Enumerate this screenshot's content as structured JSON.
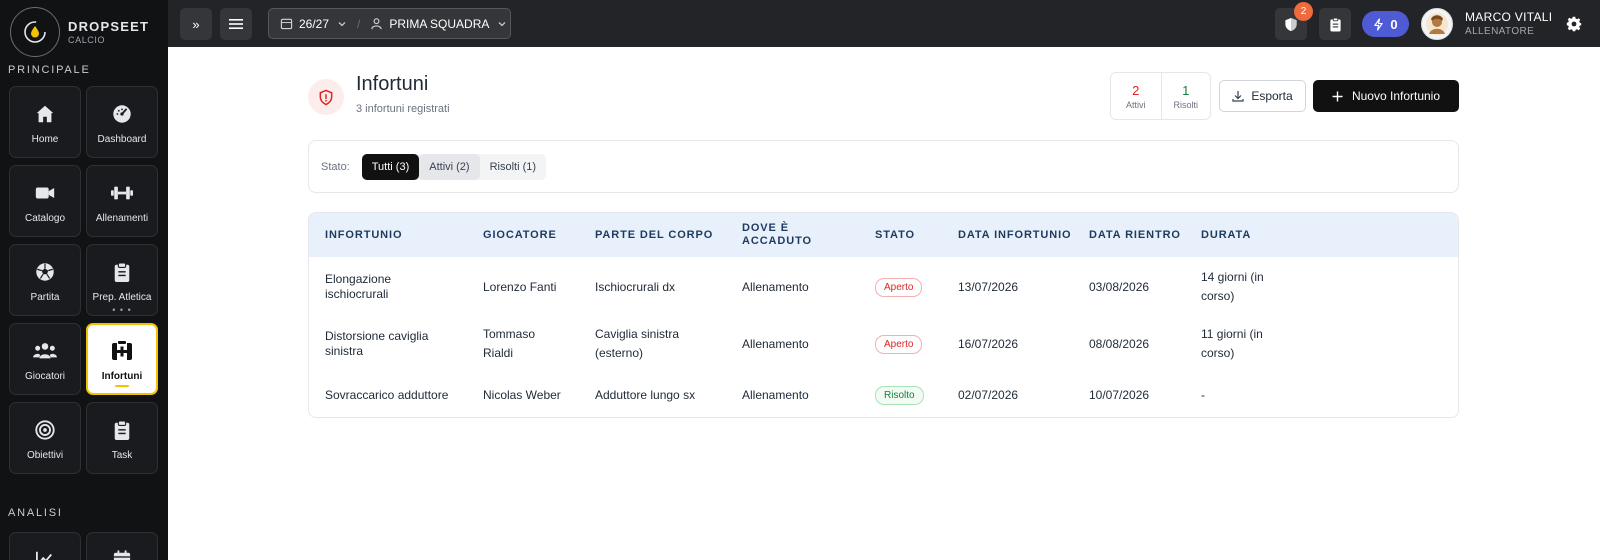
{
  "brand": {
    "name": "DROPSEET",
    "sub": "CALCIO"
  },
  "sidebar": {
    "section_main": "PRINCIPALE",
    "section_analysis": "ANALISI",
    "items": [
      {
        "label": "Home",
        "icon": "home-icon"
      },
      {
        "label": "Dashboard",
        "icon": "dashboard-icon"
      },
      {
        "label": "Catalogo",
        "icon": "video-icon"
      },
      {
        "label": "Allenamenti",
        "icon": "dumbbell-icon"
      },
      {
        "label": "Partita",
        "icon": "ball-icon"
      },
      {
        "label": "Prep. Atletica",
        "icon": "clipboard-icon"
      },
      {
        "label": "Giocatori",
        "icon": "users-icon"
      },
      {
        "label": "Infortuni",
        "icon": "medical-icon"
      },
      {
        "label": "Obiettivi",
        "icon": "target-icon"
      },
      {
        "label": "Task",
        "icon": "task-icon"
      }
    ],
    "more_dots": "• • •"
  },
  "topbar": {
    "expand_glyph": "»",
    "season": "26/27",
    "separator": "/",
    "team": "PRIMA SQUADRA",
    "notifications_count": "2",
    "energy_count": "0",
    "user_name": "MARCO VITALI",
    "user_role": "ALLENATORE"
  },
  "page": {
    "title": "Infortuni",
    "subtitle": "3 infortuni registrati",
    "stats": [
      {
        "value": "2",
        "label": "Attivi"
      },
      {
        "value": "1",
        "label": "Risolti"
      }
    ],
    "export_label": "Esporta",
    "new_label": "Nuovo Infortunio"
  },
  "filter": {
    "label": "Stato:",
    "options": [
      "Tutti (3)",
      "Attivi (2)",
      "Risolti (1)"
    ],
    "selected": "Tutti (3)"
  },
  "table": {
    "headers": [
      "INFORTUNIO",
      "GIOCATORE",
      "PARTE DEL CORPO",
      "DOVE È ACCADUTO",
      "STATO",
      "DATA INFORTUNIO",
      "DATA RIENTRO",
      "DURATA"
    ],
    "rows": [
      {
        "injury": "Elongazione ischiocrurali",
        "player": "Lorenzo Fanti",
        "body": "Ischiocrurali dx",
        "where": "Allenamento",
        "status": "Aperto",
        "date": "13/07/2026",
        "return": "03/08/2026",
        "duration": "14 giorni (in corso)"
      },
      {
        "injury": "Distorsione caviglia sinistra",
        "player": "Tommaso Rialdi",
        "body": "Caviglia sinistra (esterno)",
        "where": "Allenamento",
        "status": "Aperto",
        "date": "16/07/2026",
        "return": "08/08/2026",
        "duration": "11 giorni (in corso)"
      },
      {
        "injury": "Sovraccarico adduttore",
        "player": "Nicolas Weber",
        "body": "Adduttore lungo sx",
        "where": "Allenamento",
        "status": "Risolto",
        "date": "02/07/2026",
        "return": "10/07/2026",
        "duration": "-"
      }
    ]
  },
  "colors": {
    "accent": "#f2c200",
    "open": "#dc2626",
    "resolved": "#15803d",
    "energy": "#4f5bd5",
    "badge": "#ef6a3d"
  }
}
